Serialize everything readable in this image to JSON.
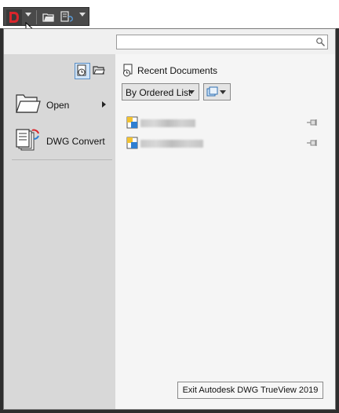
{
  "search": {
    "placeholder": "",
    "value": ""
  },
  "left_menu": {
    "items": [
      {
        "label": "Open",
        "icon": "open-folder-icon",
        "has_submenu": true
      },
      {
        "label": "DWG Convert",
        "icon": "dwg-convert-icon",
        "has_submenu": false
      }
    ]
  },
  "recent": {
    "heading": "Recent Documents",
    "sort_label": "By Ordered List",
    "documents": [
      {
        "name_blur_width": 70
      },
      {
        "name_blur_width": 80
      }
    ]
  },
  "footer": {
    "exit_label": "Exit Autodesk DWG TrueView 2019"
  },
  "colors": {
    "accent_blue": "#5c8fc4",
    "logo_red": "#d9252b"
  }
}
